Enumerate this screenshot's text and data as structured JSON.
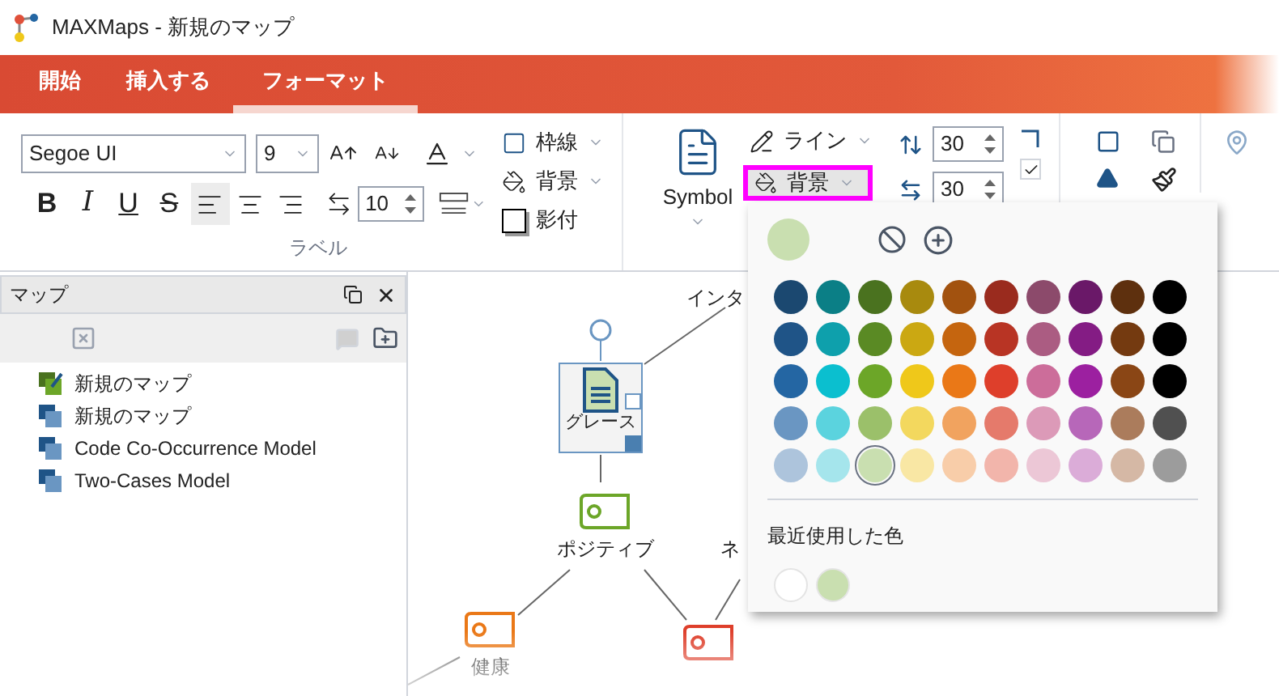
{
  "window": {
    "title": "MAXMaps - 新規のマップ"
  },
  "ribbon_tabs": [
    {
      "label": "開始",
      "selected": false
    },
    {
      "label": "挿入する",
      "selected": false
    },
    {
      "label": "フォーマット",
      "selected": true
    }
  ],
  "label_group": {
    "font": "Segoe UI",
    "size": "9",
    "styles": [
      {
        "label": "B",
        "kind": "bold"
      },
      {
        "label": "I",
        "kind": "italic"
      },
      {
        "label": "U",
        "kind": "underline"
      },
      {
        "label": "S",
        "kind": "strike"
      }
    ],
    "align_buttons": [
      {
        "kind": "left",
        "selected": true
      },
      {
        "kind": "center",
        "selected": false
      },
      {
        "kind": "right",
        "selected": false
      }
    ],
    "spacing": "10",
    "title": "ラベル"
  },
  "frame_options": [
    {
      "label": "枠線",
      "kind": "border"
    },
    {
      "label": "背景",
      "kind": "fill"
    },
    {
      "label": "影付",
      "kind": "shadow"
    }
  ],
  "symbol_button": {
    "label": "Symbol"
  },
  "line_button": {
    "label": "ライン"
  },
  "background_button": {
    "label": "背景",
    "highlighted": true
  },
  "size_spinners": [
    "30",
    "30"
  ],
  "keep_ratio": {
    "checked": true
  },
  "panel": {
    "title": "マップ",
    "items": [
      {
        "label": "新規のマップ",
        "kind": "current"
      },
      {
        "label": "新規のマップ",
        "kind": "map"
      },
      {
        "label": "Code Co-Occurrence Model",
        "kind": "map"
      },
      {
        "label": "Two-Cases Model",
        "kind": "map"
      }
    ]
  },
  "canvas": {
    "nodes": [
      {
        "kind": "text",
        "label": "インタ"
      },
      {
        "kind": "document",
        "label": "グレース",
        "selected": true
      },
      {
        "kind": "code",
        "label": "ポジティブ",
        "color": "#6ca628"
      },
      {
        "kind": "text",
        "label": "ネ"
      },
      {
        "kind": "code",
        "label": "健康",
        "color": "#ea7817"
      },
      {
        "kind": "code",
        "color": "#de3f2b"
      }
    ]
  },
  "color_picker": {
    "current": {
      "color": "#c9dfb0"
    },
    "swatches": [
      [
        {
          "color": "#1b4870",
          "selected": false
        },
        {
          "color": "#0b7f86",
          "selected": false
        },
        {
          "color": "#4a721f",
          "selected": false
        },
        {
          "color": "#a88a0e",
          "selected": false
        },
        {
          "color": "#a2520f",
          "selected": false
        },
        {
          "color": "#9a2b1e",
          "selected": false
        },
        {
          "color": "#8c4a6b",
          "selected": false
        },
        {
          "color": "#6a1868",
          "selected": false
        },
        {
          "color": "#5e300e",
          "selected": false
        },
        {
          "color": "#000000",
          "selected": false
        }
      ],
      [
        {
          "color": "#1f5487",
          "selected": false
        },
        {
          "color": "#0ea0ac",
          "selected": false
        },
        {
          "color": "#5a8a24",
          "selected": false
        },
        {
          "color": "#cba812",
          "selected": false
        },
        {
          "color": "#c5650f",
          "selected": false
        },
        {
          "color": "#b83424",
          "selected": false
        },
        {
          "color": "#ab5c82",
          "selected": false
        },
        {
          "color": "#841c84",
          "selected": false
        },
        {
          "color": "#743a10",
          "selected": false
        },
        {
          "color": "#000000",
          "selected": false
        }
      ],
      [
        {
          "color": "#2466a3",
          "selected": false
        },
        {
          "color": "#0bbfcf",
          "selected": false
        },
        {
          "color": "#6ca628",
          "selected": false
        },
        {
          "color": "#efc81a",
          "selected": false
        },
        {
          "color": "#ea7817",
          "selected": false
        },
        {
          "color": "#de3f2b",
          "selected": false
        },
        {
          "color": "#cc6d9a",
          "selected": false
        },
        {
          "color": "#9c20a0",
          "selected": false
        },
        {
          "color": "#8a4615",
          "selected": false
        },
        {
          "color": "#000000",
          "selected": false
        }
      ],
      [
        {
          "color": "#6a96c2",
          "selected": false
        },
        {
          "color": "#5bd3de",
          "selected": false
        },
        {
          "color": "#9bc06a",
          "selected": false
        },
        {
          "color": "#f3d85e",
          "selected": false
        },
        {
          "color": "#f1a35f",
          "selected": false
        },
        {
          "color": "#e57a6b",
          "selected": false
        },
        {
          "color": "#dc9ab8",
          "selected": false
        },
        {
          "color": "#b767b9",
          "selected": false
        },
        {
          "color": "#ab7c5c",
          "selected": false
        },
        {
          "color": "#505050",
          "selected": false
        }
      ],
      [
        {
          "color": "#adc4dc",
          "selected": false
        },
        {
          "color": "#a5e5ec",
          "selected": false
        },
        {
          "color": "#c9dfb0",
          "selected": true
        },
        {
          "color": "#f9e7a4",
          "selected": false
        },
        {
          "color": "#f8cda9",
          "selected": false
        },
        {
          "color": "#f2b5ab",
          "selected": false
        },
        {
          "color": "#ecc7d6",
          "selected": false
        },
        {
          "color": "#dbacd8",
          "selected": false
        },
        {
          "color": "#d5b8a5",
          "selected": false
        },
        {
          "color": "#9c9c9c",
          "selected": false
        }
      ]
    ],
    "recent_title": "最近使用した色",
    "recent": [
      {
        "color": "#ffffff"
      },
      {
        "color": "#c9dfb0"
      }
    ]
  }
}
